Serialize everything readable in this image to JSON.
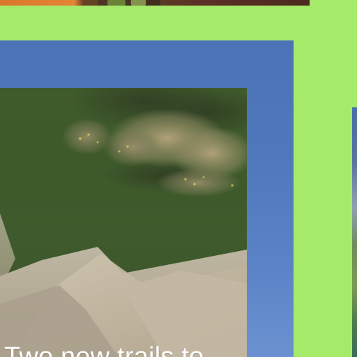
{
  "story": {
    "caption": "Two new trails to"
  },
  "colors": {
    "page_background": "#a6ea6a",
    "card_frame": "#4f78bc",
    "caption_text": "#ffffff"
  },
  "icons": {
    "scene_image": "landscape-photo-icon"
  }
}
